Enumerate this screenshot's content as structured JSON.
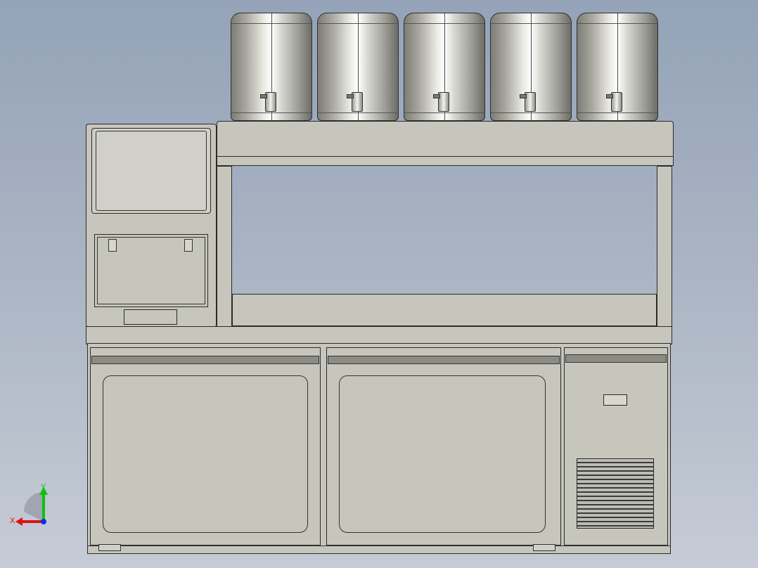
{
  "scene": {
    "description_free": true,
    "palette": {
      "background_top": "#94a3b8",
      "background_bottom": "#c6ccd6",
      "cabinet_fill": "#c6c6bd",
      "outline": "#2a2a2a",
      "steel": "#e9e9e3"
    }
  },
  "canisters": [
    {
      "name": "canister-1"
    },
    {
      "name": "canister-2"
    },
    {
      "name": "canister-3"
    },
    {
      "name": "canister-4"
    },
    {
      "name": "canister-5"
    }
  ],
  "triad": {
    "x_label": "X",
    "y_label": "Y",
    "x_color": "#e01010",
    "y_color": "#10c010",
    "z_color": "#1030e0"
  }
}
